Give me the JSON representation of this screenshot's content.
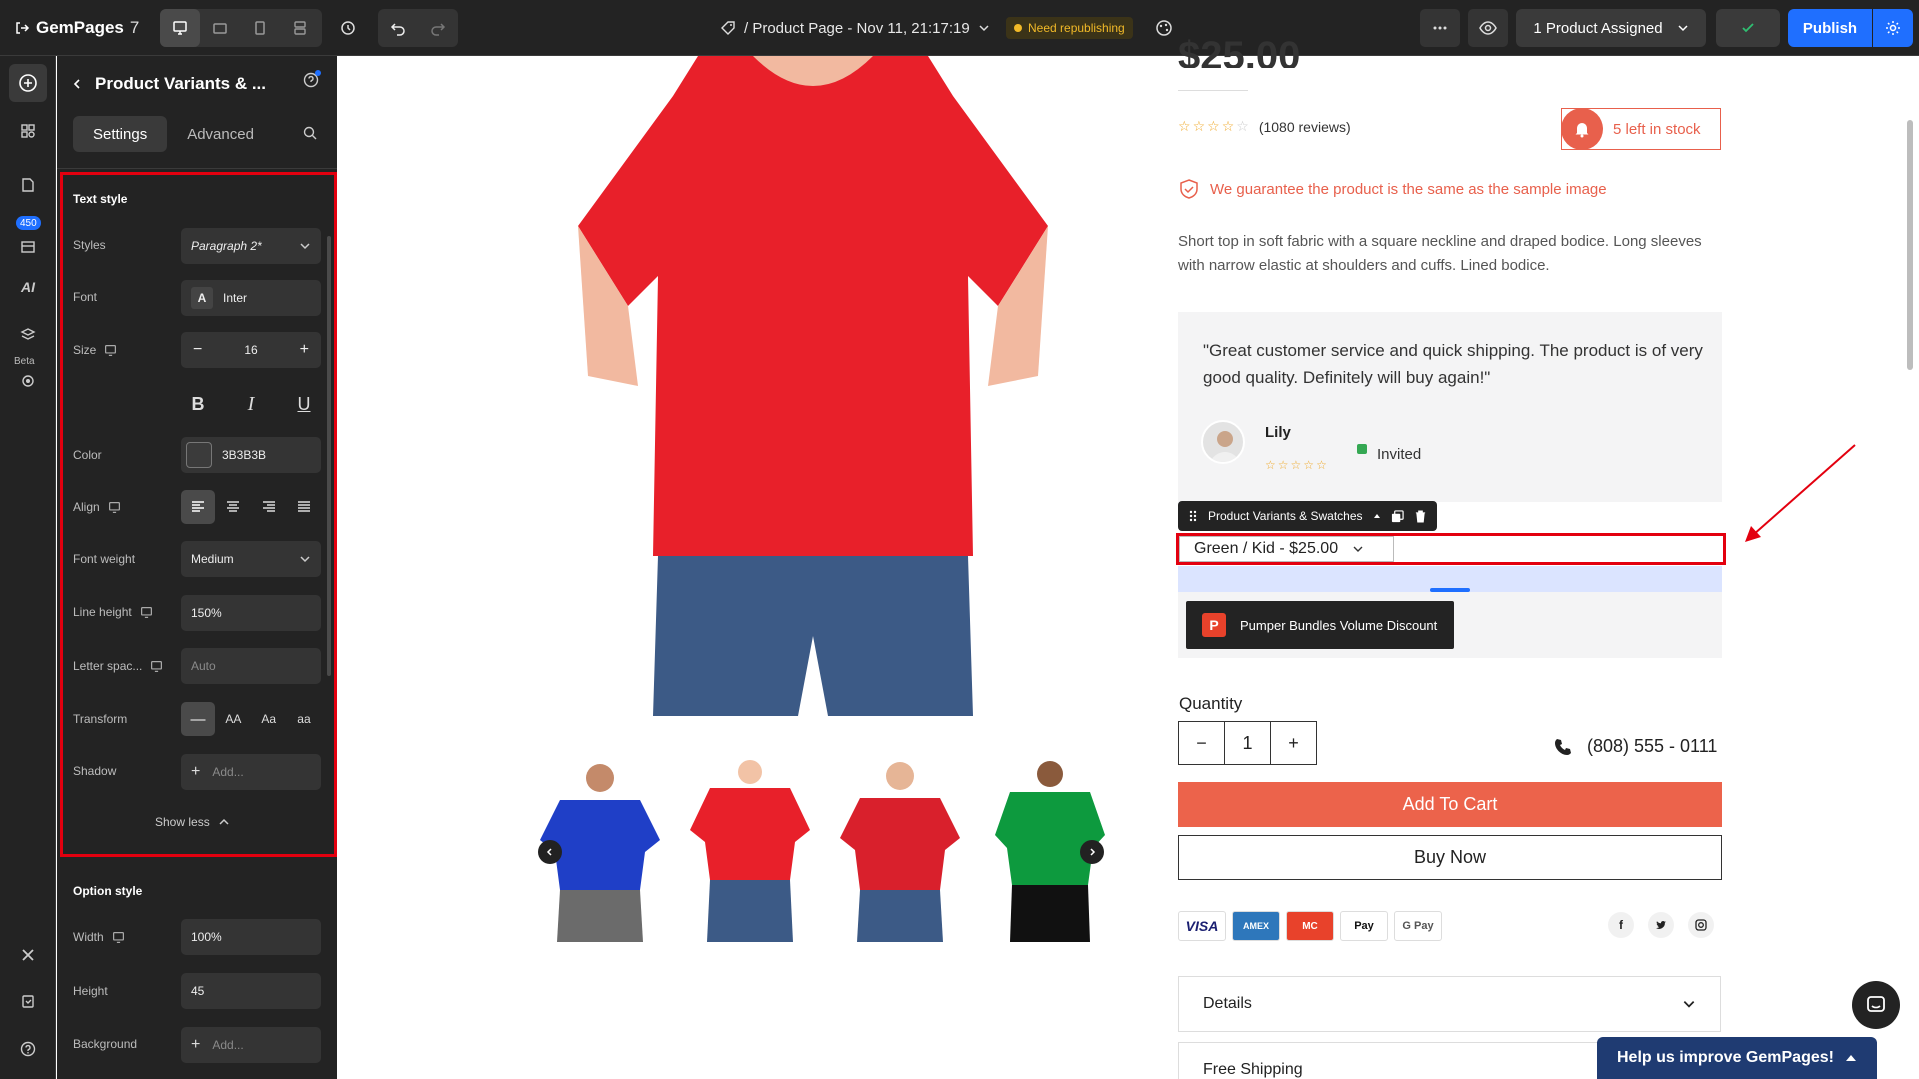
{
  "topbar": {
    "brand": "GemPages",
    "version": "7",
    "page_title": "/ Product Page - Nov 11, 21:17:19",
    "status_badge": "Need republishing",
    "assigned_label": "1 Product Assigned",
    "publish_label": "Publish"
  },
  "rail": {
    "count_badge": "450",
    "beta_label": "Beta",
    "ai_label": "AI"
  },
  "panel": {
    "title": "Product Variants & ...",
    "tabs": [
      "Settings",
      "Advanced"
    ],
    "text_style": {
      "section": "Text style",
      "styles_label": "Styles",
      "styles_value": "Paragraph 2*",
      "font_label": "Font",
      "font_value": "Inter",
      "size_label": "Size",
      "size_value": "16",
      "color_label": "Color",
      "color_value": "3B3B3B",
      "align_label": "Align",
      "weight_label": "Font weight",
      "weight_value": "Medium",
      "lineheight_label": "Line height",
      "lineheight_value": "150%",
      "letter_label": "Letter spac...",
      "letter_placeholder": "Auto",
      "transform_label": "Transform",
      "transform_options": [
        "—",
        "AA",
        "Aa",
        "aa"
      ],
      "shadow_label": "Shadow",
      "shadow_placeholder": "Add...",
      "show_less": "Show less"
    },
    "option_style": {
      "section": "Option style",
      "width_label": "Width",
      "width_value": "100%",
      "height_label": "Height",
      "height_value": "45",
      "background_label": "Background",
      "background_placeholder": "Add..."
    }
  },
  "product": {
    "price": "$25.00",
    "reviews": "(1080 reviews)",
    "stock": "5 left in stock",
    "guarantee": "We guarantee the product is the same as the sample image",
    "description": "Short top in soft fabric with a square neckline and draped bodice. Long sleeves with narrow elastic at shoulders and cuffs. Lined bodice.",
    "testimonial": "\"Great customer service and quick shipping. The product is of very good quality. Definitely will buy again!\"",
    "author": "Lily",
    "invited": "Invited",
    "element_label": "Product Variants & Swatches",
    "variant_value": "Green / Kid - $25.00",
    "bundle_label": "Pumper Bundles Volume Discount",
    "quantity_label": "Quantity",
    "quantity_value": "1",
    "phone": "(808) 555 - 0111",
    "add_to_cart": "Add To Cart",
    "buy_now": "Buy Now",
    "payments": [
      "VISA",
      "AMEX",
      "MC",
      "Pay",
      "G Pay"
    ],
    "accordions": [
      "Details",
      "Free Shipping"
    ]
  },
  "help_bar": "Help us improve GemPages!",
  "colors": {
    "accent": "#1f6fff",
    "cart": "#ec634b",
    "shirt_red": "#e8202a",
    "shirt_blue": "#1f3fc7",
    "shirt_green": "#0d9a3e",
    "jeans": "#3c5a86"
  }
}
